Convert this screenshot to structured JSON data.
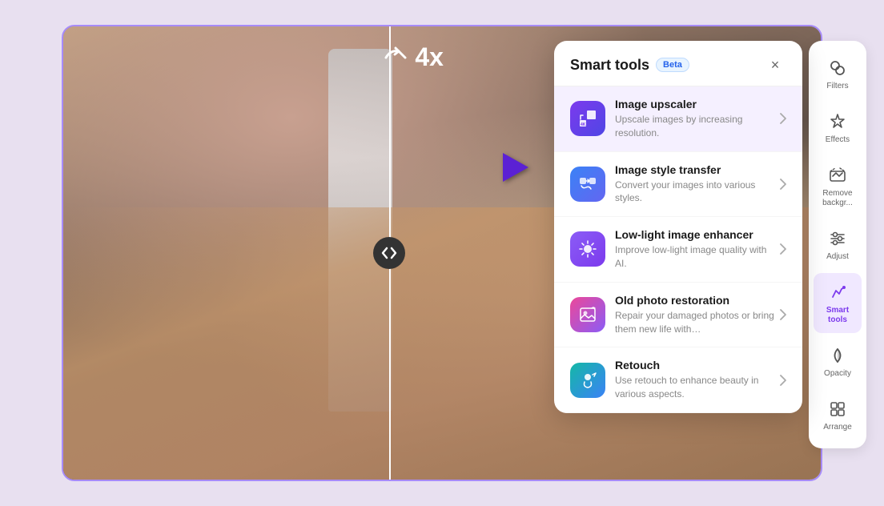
{
  "canvas": {
    "zoom_label": "4x",
    "split_handle_icon": "⬡"
  },
  "panel": {
    "title": "Smart tools",
    "beta_label": "Beta",
    "close_label": "×",
    "tools": [
      {
        "id": "image-upscaler",
        "name": "Image upscaler",
        "desc": "Upscale images by increasing resolution.",
        "icon_type": "purple-grad",
        "active": true
      },
      {
        "id": "image-style-transfer",
        "name": "Image style transfer",
        "desc": "Convert your images into various styles.",
        "icon_type": "blue-grad",
        "active": false
      },
      {
        "id": "low-light-enhancer",
        "name": "Low-light image enhancer",
        "desc": "Improve low-light image quality with AI.",
        "icon_type": "violet-grad",
        "active": false
      },
      {
        "id": "old-photo-restoration",
        "name": "Old photo restoration",
        "desc": "Repair your damaged photos or bring them new life with…",
        "icon_type": "pink-grad",
        "active": false
      },
      {
        "id": "retouch",
        "name": "Retouch",
        "desc": "Use retouch to enhance beauty in various aspects.",
        "icon_type": "teal-grad",
        "active": false
      }
    ]
  },
  "sidebar": {
    "tools": [
      {
        "id": "filters",
        "label": "Filters",
        "icon": "filters",
        "active": false
      },
      {
        "id": "effects",
        "label": "Effects",
        "icon": "effects",
        "active": false
      },
      {
        "id": "remove-background",
        "label": "Remove backgr...",
        "icon": "remove-bg",
        "active": false
      },
      {
        "id": "adjust",
        "label": "Adjust",
        "icon": "adjust",
        "active": false
      },
      {
        "id": "smart-tools",
        "label": "Smart tools",
        "icon": "smart-tools",
        "active": true
      },
      {
        "id": "opacity",
        "label": "Opacity",
        "icon": "opacity",
        "active": false
      },
      {
        "id": "arrange",
        "label": "Arrange",
        "icon": "arrange",
        "active": false
      }
    ]
  }
}
